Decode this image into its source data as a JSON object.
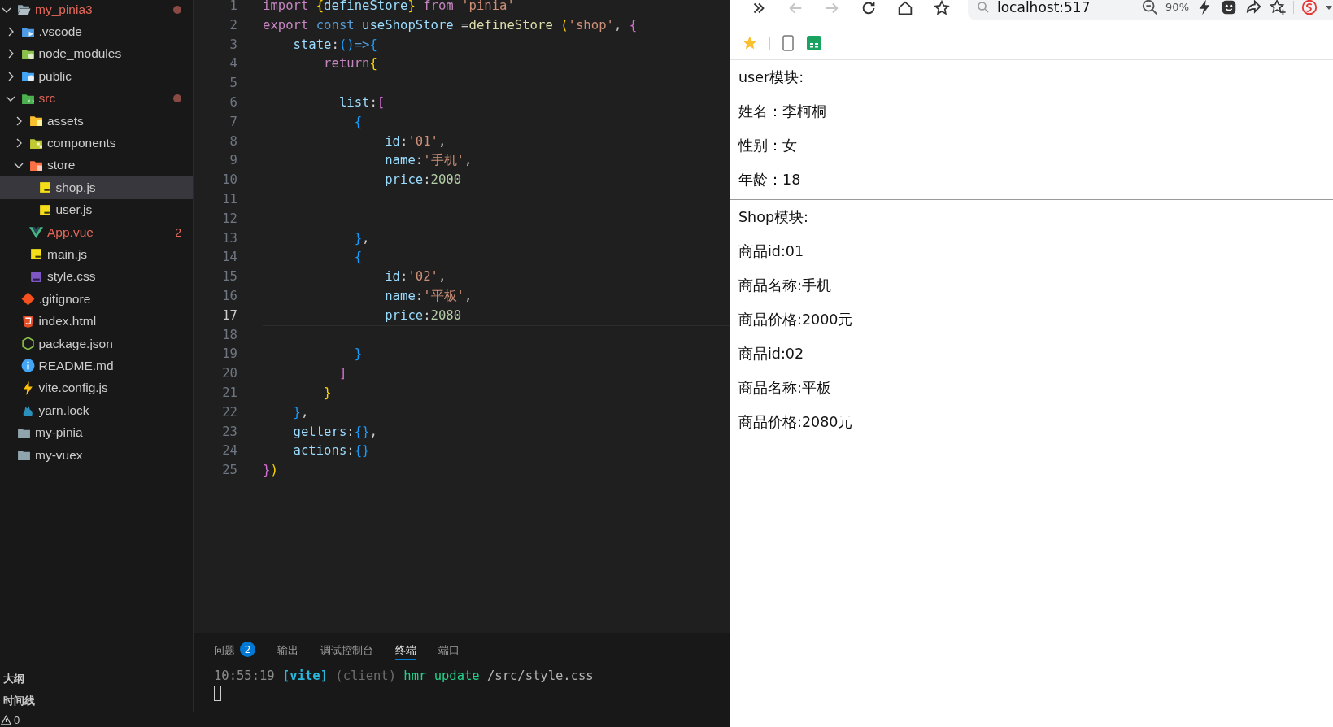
{
  "explorer": {
    "tree": [
      {
        "name": "my_pinia3",
        "kind": "folder-open",
        "expanded": true,
        "modified": true,
        "selected": false,
        "children": [
          {
            "name": ".vscode",
            "kind": "folder-vscode",
            "expanded": false,
            "modified": false,
            "selected": false
          },
          {
            "name": "node_modules",
            "kind": "folder-node",
            "expanded": false,
            "modified": false,
            "selected": false
          },
          {
            "name": "public",
            "kind": "folder-public",
            "expanded": false,
            "modified": false,
            "selected": false
          },
          {
            "name": "src",
            "kind": "folder-src",
            "expanded": true,
            "modified": true,
            "selected": false,
            "children": [
              {
                "name": "assets",
                "kind": "folder-assets",
                "expanded": false,
                "modified": false,
                "selected": false
              },
              {
                "name": "components",
                "kind": "folder-components",
                "expanded": false,
                "modified": false,
                "selected": false
              },
              {
                "name": "store",
                "kind": "folder-store",
                "expanded": true,
                "modified": false,
                "selected": false,
                "children": [
                  {
                    "name": "shop.js",
                    "kind": "js",
                    "modified": false,
                    "selected": true
                  },
                  {
                    "name": "user.js",
                    "kind": "js",
                    "modified": false,
                    "selected": false
                  }
                ]
              },
              {
                "name": "App.vue",
                "kind": "vue",
                "modified": true,
                "badge": "2",
                "selected": false
              },
              {
                "name": "main.js",
                "kind": "js",
                "modified": false,
                "selected": false
              },
              {
                "name": "style.css",
                "kind": "css",
                "modified": false,
                "selected": false
              }
            ]
          },
          {
            "name": ".gitignore",
            "kind": "git",
            "modified": false,
            "selected": false
          },
          {
            "name": "index.html",
            "kind": "html",
            "modified": false,
            "selected": false
          },
          {
            "name": "package.json",
            "kind": "node",
            "modified": false,
            "selected": false
          },
          {
            "name": "README.md",
            "kind": "info",
            "modified": false,
            "selected": false
          },
          {
            "name": "vite.config.js",
            "kind": "vite",
            "modified": false,
            "selected": false
          },
          {
            "name": "yarn.lock",
            "kind": "yarn",
            "modified": false,
            "selected": false
          }
        ]
      },
      {
        "name": "my-pinia",
        "kind": "folder-plain",
        "modified": false,
        "selected": false
      },
      {
        "name": "my-vuex",
        "kind": "folder-plain",
        "modified": false,
        "selected": false
      }
    ],
    "sections": [
      "大纲",
      "时间线"
    ]
  },
  "editor": {
    "lines": [
      {
        "number": "1",
        "current": false,
        "tokens": [
          {
            "t": "import ",
            "kind": "keyword"
          },
          {
            "t": "{",
            "kind": "b1"
          },
          {
            "t": "defineStore",
            "kind": "var"
          },
          {
            "t": "}",
            "kind": "b1"
          },
          {
            "t": " from ",
            "kind": "keyword"
          },
          {
            "t": "'pinia'",
            "kind": "string"
          }
        ]
      },
      {
        "number": "2",
        "current": false,
        "tokens": [
          {
            "t": "export",
            "kind": "keyword"
          },
          {
            "t": " const ",
            "kind": "storage"
          },
          {
            "t": "useShopStore",
            "kind": "var"
          },
          {
            "t": " =",
            "kind": "plain"
          },
          {
            "t": "defineStore",
            "kind": "func"
          },
          {
            "t": " (",
            "kind": "b1"
          },
          {
            "t": "'shop'",
            "kind": "string"
          },
          {
            "t": ", ",
            "kind": "plain"
          },
          {
            "t": "{",
            "kind": "b2"
          }
        ]
      },
      {
        "number": "3",
        "current": false,
        "tokens": [
          {
            "t": "    state",
            "kind": "var"
          },
          {
            "t": ":",
            "kind": "plain"
          },
          {
            "t": "()",
            "kind": "b3"
          },
          {
            "t": "=>",
            "kind": "storage"
          },
          {
            "t": "{",
            "kind": "b3"
          }
        ]
      },
      {
        "number": "4",
        "current": false,
        "tokens": [
          {
            "t": "        return",
            "kind": "keyword"
          },
          {
            "t": "{",
            "kind": "b1"
          }
        ]
      },
      {
        "number": "5",
        "current": false
      },
      {
        "number": "6",
        "current": false,
        "tokens": [
          {
            "t": "          list",
            "kind": "var"
          },
          {
            "t": ":",
            "kind": "plain"
          },
          {
            "t": "[",
            "kind": "b2"
          }
        ]
      },
      {
        "number": "7",
        "current": false,
        "tokens": [
          {
            "t": "            {",
            "kind": "b3"
          }
        ]
      },
      {
        "number": "8",
        "current": false,
        "tokens": [
          {
            "t": "                id",
            "kind": "var"
          },
          {
            "t": ":",
            "kind": "plain"
          },
          {
            "t": "'01'",
            "kind": "string"
          },
          {
            "t": ",",
            "kind": "plain"
          }
        ]
      },
      {
        "number": "9",
        "current": false,
        "tokens": [
          {
            "t": "                name",
            "kind": "var"
          },
          {
            "t": ":",
            "kind": "plain"
          },
          {
            "t": "'手机'",
            "kind": "string"
          },
          {
            "t": ",",
            "kind": "plain"
          }
        ]
      },
      {
        "number": "10",
        "current": false,
        "tokens": [
          {
            "t": "                price",
            "kind": "var"
          },
          {
            "t": ":",
            "kind": "plain"
          },
          {
            "t": "2000",
            "kind": "number"
          }
        ]
      },
      {
        "number": "11",
        "current": false
      },
      {
        "number": "12",
        "current": false
      },
      {
        "number": "13",
        "current": false,
        "tokens": [
          {
            "t": "            }",
            "kind": "b3"
          },
          {
            "t": ",",
            "kind": "plain"
          }
        ]
      },
      {
        "number": "14",
        "current": false,
        "tokens": [
          {
            "t": "            {",
            "kind": "b3"
          }
        ]
      },
      {
        "number": "15",
        "current": false,
        "tokens": [
          {
            "t": "                id",
            "kind": "var"
          },
          {
            "t": ":",
            "kind": "plain"
          },
          {
            "t": "'02'",
            "kind": "string"
          },
          {
            "t": ",",
            "kind": "plain"
          }
        ]
      },
      {
        "number": "16",
        "current": false,
        "tokens": [
          {
            "t": "                name",
            "kind": "var"
          },
          {
            "t": ":",
            "kind": "plain"
          },
          {
            "t": "'平板'",
            "kind": "string"
          },
          {
            "t": ",",
            "kind": "plain"
          }
        ]
      },
      {
        "number": "17",
        "current": true,
        "tokens": [
          {
            "t": "                price",
            "kind": "var"
          },
          {
            "t": ":",
            "kind": "plain"
          },
          {
            "t": "2080",
            "kind": "number"
          }
        ]
      },
      {
        "number": "18",
        "current": false
      },
      {
        "number": "19",
        "current": false,
        "tokens": [
          {
            "t": "            }",
            "kind": "b3"
          }
        ]
      },
      {
        "number": "20",
        "current": false,
        "tokens": [
          {
            "t": "          ]",
            "kind": "b2"
          }
        ]
      },
      {
        "number": "21",
        "current": false,
        "tokens": [
          {
            "t": "        }",
            "kind": "b1"
          }
        ]
      },
      {
        "number": "22",
        "current": false,
        "tokens": [
          {
            "t": "    }",
            "kind": "b3"
          },
          {
            "t": ",",
            "kind": "plain"
          }
        ]
      },
      {
        "number": "23",
        "current": false,
        "tokens": [
          {
            "t": "    getters",
            "kind": "var"
          },
          {
            "t": ":",
            "kind": "plain"
          },
          {
            "t": "{}",
            "kind": "b3"
          },
          {
            "t": ",",
            "kind": "plain"
          }
        ]
      },
      {
        "number": "24",
        "current": false,
        "tokens": [
          {
            "t": "    actions",
            "kind": "var"
          },
          {
            "t": ":",
            "kind": "plain"
          },
          {
            "t": "{}",
            "kind": "b3"
          }
        ]
      },
      {
        "number": "25",
        "current": false,
        "tokens": [
          {
            "t": "}",
            "kind": "b2"
          },
          {
            "t": ")",
            "kind": "b1"
          }
        ]
      }
    ]
  },
  "panel": {
    "tabs": [
      {
        "label": "问题",
        "badge": "2",
        "selected": false
      },
      {
        "label": "输出",
        "selected": false
      },
      {
        "label": "调试控制台",
        "selected": false
      },
      {
        "label": "终端",
        "selected": true
      },
      {
        "label": "端口",
        "selected": false
      }
    ],
    "terminal": [
      {
        "t": "10:55:19 ",
        "kind": "time"
      },
      {
        "t": "[vite]",
        "kind": "tag"
      },
      {
        "t": " (client) ",
        "kind": "dim"
      },
      {
        "t": "hmr update",
        "kind": "green"
      },
      {
        "t": " /src/style.css",
        "kind": "path"
      }
    ]
  },
  "status_bar": {
    "warnings": "0"
  },
  "browser": {
    "address": "localhost:517",
    "zoom": "90%",
    "content": [
      {
        "kind": "text",
        "text": "user模块:"
      },
      {
        "kind": "text",
        "text": "姓名：李柯桐"
      },
      {
        "kind": "text",
        "text": "性别：女"
      },
      {
        "kind": "text",
        "text": "年龄：18"
      },
      {
        "kind": "rule"
      },
      {
        "kind": "text",
        "text": "Shop模块:"
      },
      {
        "kind": "text",
        "text": "商品id:01"
      },
      {
        "kind": "text",
        "text": "商品名称:手机"
      },
      {
        "kind": "text",
        "text": "商品价格:2000元"
      },
      {
        "kind": "text",
        "text": "商品id:02"
      },
      {
        "kind": "text",
        "text": "商品名称:平板"
      },
      {
        "kind": "text",
        "text": "商品价格:2080元"
      }
    ]
  }
}
